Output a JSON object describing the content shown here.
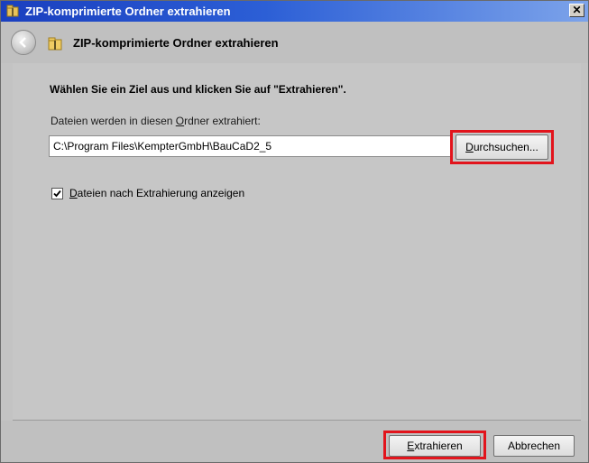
{
  "window": {
    "title": "ZIP-komprimierte Ordner extrahieren"
  },
  "nav": {
    "title": "ZIP-komprimierte Ordner extrahieren"
  },
  "content": {
    "heading": "Wählen Sie ein Ziel aus und klicken Sie auf \"Extrahieren\".",
    "label": {
      "pre": "Dateien werden in diesen ",
      "ul": "O",
      "post": "rdner extrahiert:"
    },
    "path_value": "C:\\Program Files\\KempterGmbH\\BauCaD2_5",
    "browse_button": {
      "ul": "D",
      "post": "urchsuchen..."
    },
    "show_files": {
      "checked": true,
      "ul": "D",
      "post": "ateien nach Extrahierung anzeigen"
    }
  },
  "footer": {
    "extract_button": {
      "ul": "E",
      "post": "xtrahieren"
    },
    "cancel_button": "Abbrechen"
  },
  "colors": {
    "highlight": "#e2141c",
    "titlebar": "#2c5fd6"
  },
  "icons": [
    "folder-zip-icon",
    "back-arrow-icon",
    "close-icon",
    "checkmark-icon"
  ]
}
